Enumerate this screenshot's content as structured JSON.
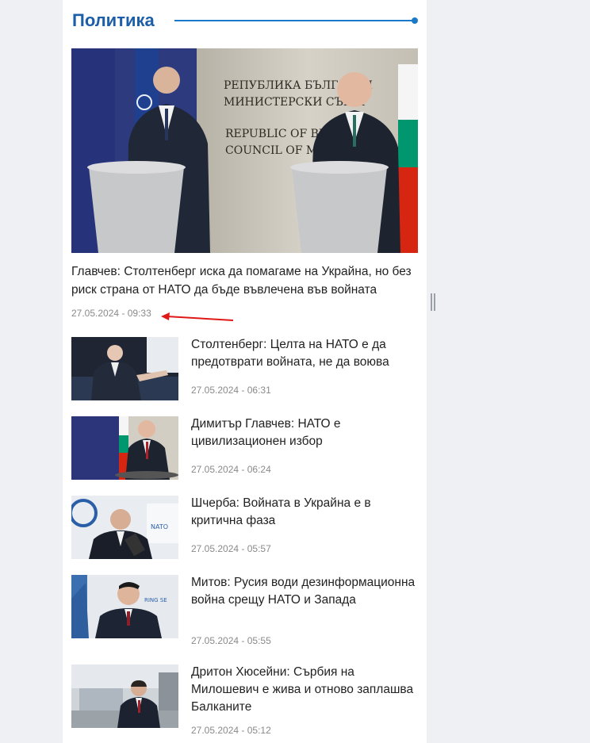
{
  "section": {
    "title": "Политика"
  },
  "featured": {
    "title": "Главчев: Столтенберг иска да помагаме на Украйна, но без риск страна от НАТО да бъде въвлечена във войната",
    "date": "27.05.2024 - 09:33",
    "image_alt": "Столтенберг и Главчев на пресконференция",
    "backdrop_lines": [
      "РЕПУБЛИКА БЪЛГАРИЯ",
      "МИНИСТЕРСКИ СЪВЕТ",
      "REPUBLIC OF BULGARIA",
      "COUNCIL OF MINISTERS"
    ]
  },
  "items": [
    {
      "title": "Столтенберг: Целта на НАТО е да предотврати войната, не да воюва",
      "date": "27.05.2024 - 06:31"
    },
    {
      "title": "Димитър Главчев: НАТО е цивилизационен избор",
      "date": "27.05.2024 - 06:24"
    },
    {
      "title": "Шчерба: Войната в Украйна е в критична фаза",
      "date": "27.05.2024 - 05:57"
    },
    {
      "title": "Митов: Русия води дезинформационна война срещу НАТО и Запада",
      "date": "27.05.2024 - 05:55"
    },
    {
      "title": "Дритон Хюсейни: Сърбия на Милошевич е жива и отново заплашва Балканите",
      "date": "27.05.2024 - 05:12"
    }
  ],
  "colors": {
    "accent": "#1c5ea8",
    "line": "#1c79c8",
    "annotation": "#e01818"
  }
}
